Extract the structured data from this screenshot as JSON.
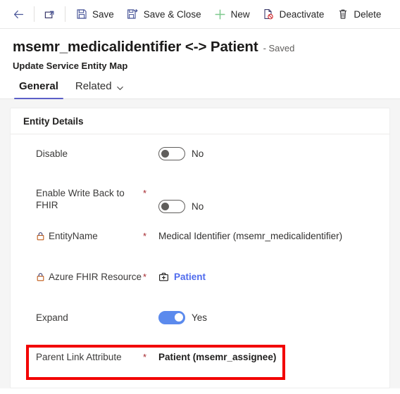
{
  "commandbar": {
    "buttons": [
      {
        "id": "back",
        "label": "",
        "icon": "back-arrow-icon"
      },
      {
        "id": "popout",
        "label": "",
        "icon": "popout-icon"
      },
      {
        "id": "save",
        "label": "Save",
        "icon": "save-icon"
      },
      {
        "id": "save-close",
        "label": "Save & Close",
        "icon": "save-and-close-icon"
      },
      {
        "id": "new",
        "label": "New",
        "icon": "plus-icon"
      },
      {
        "id": "deactivate",
        "label": "Deactivate",
        "icon": "deactivate-icon"
      },
      {
        "id": "delete",
        "label": "Delete",
        "icon": "trash-icon"
      }
    ]
  },
  "record": {
    "title": "msemr_medicalidentifier <-> Patient",
    "status": "- Saved",
    "subtitle": "Update Service Entity Map"
  },
  "tabs": [
    {
      "id": "general",
      "label": "General",
      "active": true,
      "has_chevron": false
    },
    {
      "id": "related",
      "label": "Related",
      "active": false,
      "has_chevron": true
    }
  ],
  "section": {
    "header": "Entity Details",
    "fields": [
      {
        "id": "disable",
        "label": "Disable",
        "required": false,
        "locked": false,
        "type": "toggle",
        "toggle_on": false,
        "value": "No"
      },
      {
        "id": "enable-write-back-to-fhir",
        "label": "Enable Write Back to FHIR",
        "required": true,
        "locked": false,
        "type": "toggle",
        "toggle_on": false,
        "value": "No"
      },
      {
        "id": "entityname",
        "label": "EntityName",
        "required": true,
        "locked": true,
        "type": "text",
        "value": "Medical Identifier (msemr_medicalidentifier)"
      },
      {
        "id": "azure-fhir-resource",
        "label": "Azure FHIR Resource",
        "required": true,
        "locked": true,
        "type": "lookup",
        "icon": "medical-bag-icon",
        "value": "Patient"
      },
      {
        "id": "expand",
        "label": "Expand",
        "required": false,
        "locked": false,
        "type": "toggle",
        "toggle_on": true,
        "value": "Yes"
      },
      {
        "id": "parent-link-attribute",
        "label": "Parent Link Attribute",
        "required": true,
        "locked": false,
        "type": "text-bold",
        "value": "Patient (msemr_assignee)"
      }
    ]
  },
  "annotation": {
    "highlight_color": "#f20000",
    "target_field": "parent-link-attribute"
  },
  "colors": {
    "accent": "#5b5fc7",
    "link": "#4f6bed",
    "toggle_on": "#5b8aed",
    "required_asterisk": "#a4262c",
    "highlight": "#f20000"
  }
}
